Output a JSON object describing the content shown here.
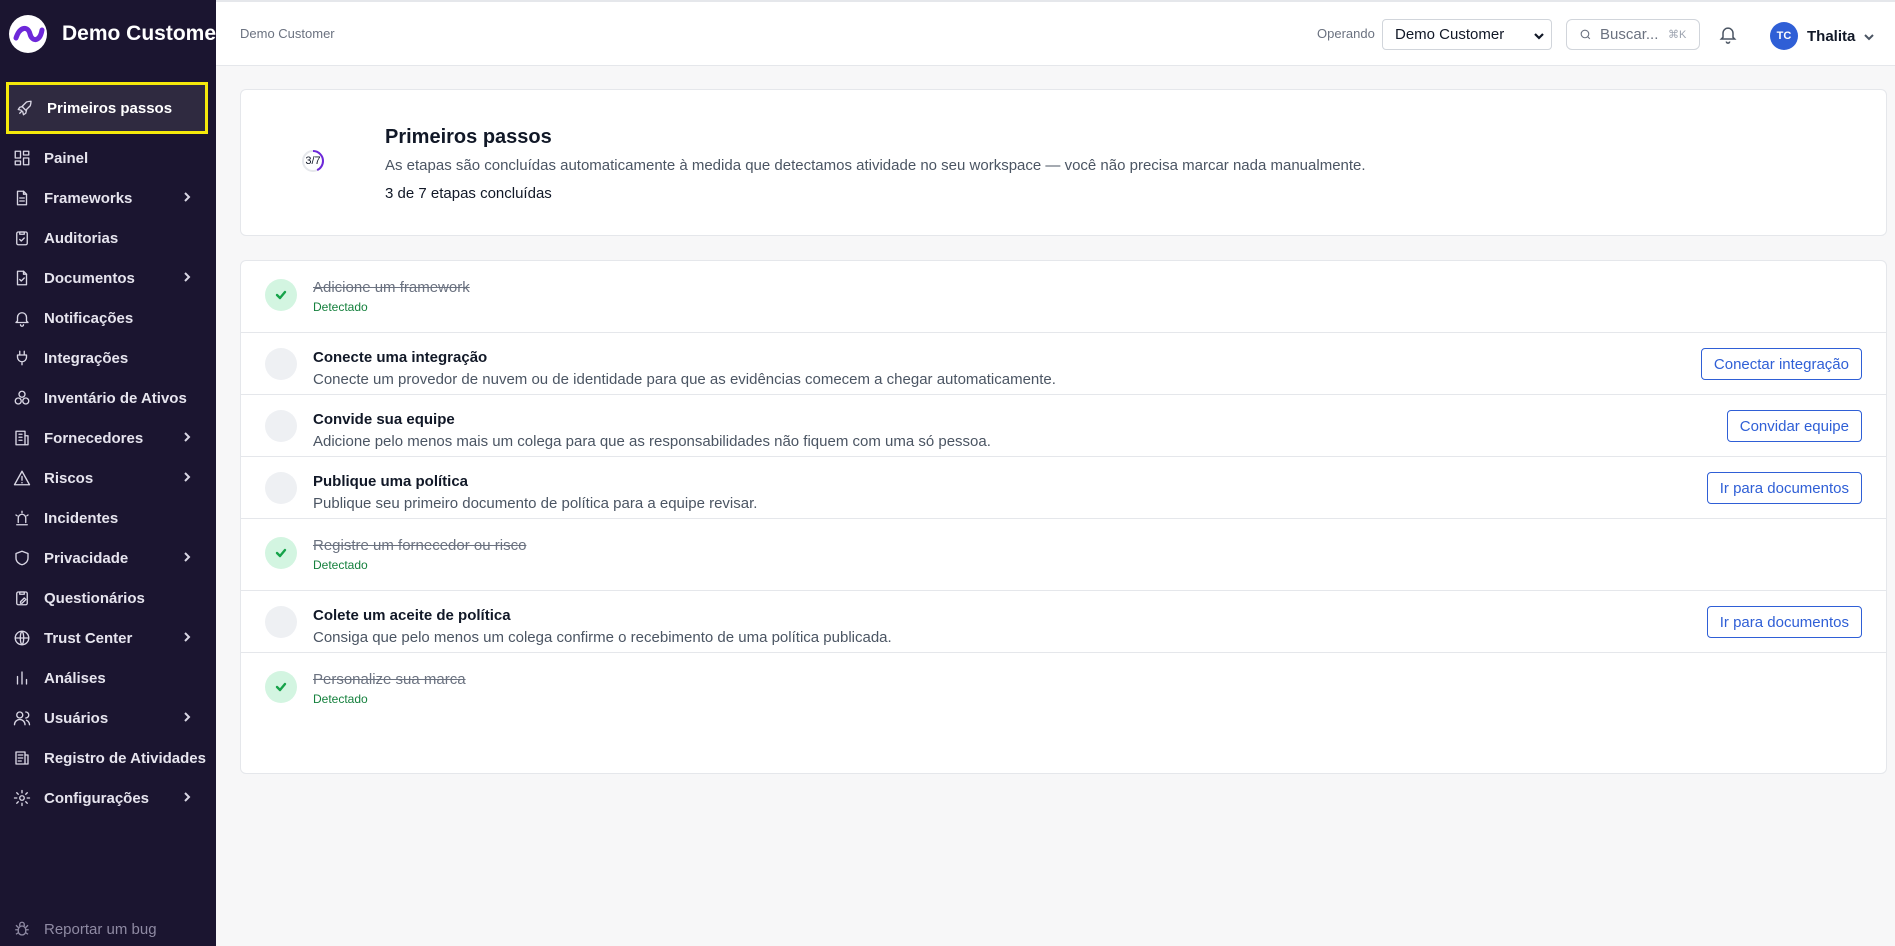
{
  "app": {
    "brand_name": "Demo Customer"
  },
  "sidebar": {
    "items": [
      {
        "label": "Primeiros passos",
        "icon": "rocket-icon",
        "active": true,
        "has_children": false
      },
      {
        "label": "Painel",
        "icon": "dashboard-icon",
        "has_children": false
      },
      {
        "label": "Frameworks",
        "icon": "file-text-icon",
        "has_children": true
      },
      {
        "label": "Auditorias",
        "icon": "clipboard-check-icon",
        "has_children": false
      },
      {
        "label": "Documentos",
        "icon": "file-check-icon",
        "has_children": true
      },
      {
        "label": "Notificações",
        "icon": "bell-icon",
        "has_children": false
      },
      {
        "label": "Integrações",
        "icon": "plug-icon",
        "has_children": false
      },
      {
        "label": "Inventário de Ativos",
        "icon": "boxes-icon",
        "has_children": false
      },
      {
        "label": "Fornecedores",
        "icon": "building-icon",
        "has_children": true
      },
      {
        "label": "Riscos",
        "icon": "warning-triangle-icon",
        "has_children": true
      },
      {
        "label": "Incidentes",
        "icon": "siren-icon",
        "has_children": false
      },
      {
        "label": "Privacidade",
        "icon": "shield-icon",
        "has_children": true
      },
      {
        "label": "Questionários",
        "icon": "clipboard-pen-icon",
        "has_children": false
      },
      {
        "label": "Trust Center",
        "icon": "globe-icon",
        "has_children": true
      },
      {
        "label": "Análises",
        "icon": "bar-chart-icon",
        "has_children": false
      },
      {
        "label": "Usuários",
        "icon": "users-icon",
        "has_children": true
      },
      {
        "label": "Registro de Atividades",
        "icon": "logs-icon",
        "has_children": false
      },
      {
        "label": "Configurações",
        "icon": "gear-icon",
        "has_children": true
      }
    ],
    "footer": {
      "label": "Reportar um bug",
      "icon": "bug-icon"
    }
  },
  "header": {
    "breadcrumb": "Demo Customer",
    "operando_label": "Operando",
    "operando_value": "Demo Customer",
    "search_placeholder": "Buscar...",
    "search_shortcut": "⌘K",
    "user": {
      "initials": "TC",
      "name": "Thalita"
    }
  },
  "summary": {
    "progress_label": "3/7",
    "progress_done": 3,
    "progress_total": 7,
    "title": "Primeiros passos",
    "description": "As etapas são concluídas automaticamente à medida que detectamos atividade no seu workspace — você não precisa marcar nada manualmente.",
    "count_text": "3 de 7 etapas concluídas"
  },
  "steps": [
    {
      "title": "Adicione um framework",
      "done": true,
      "status": "Detectado"
    },
    {
      "title": "Conecte uma integração",
      "done": false,
      "description": "Conecte um provedor de nuvem ou de identidade para que as evidências comecem a chegar automaticamente.",
      "action": "Conectar integração"
    },
    {
      "title": "Convide sua equipe",
      "done": false,
      "description": "Adicione pelo menos mais um colega para que as responsabilidades não fiquem com uma só pessoa.",
      "action": "Convidar equipe"
    },
    {
      "title": "Publique uma política",
      "done": false,
      "description": "Publique seu primeiro documento de política para a equipe revisar.",
      "action": "Ir para documentos"
    },
    {
      "title": "Registre um fornecedor ou risco",
      "done": true,
      "status": "Detectado"
    },
    {
      "title": "Colete um aceite de política",
      "done": false,
      "description": "Consiga que pelo menos um colega confirme o recebimento de uma política publicada.",
      "action": "Ir para documentos"
    },
    {
      "title": "Personalize sua marca",
      "done": true,
      "status": "Detectado"
    }
  ],
  "colors": {
    "sidebar_bg": "#1b1530",
    "accent": "#2f5fd6",
    "success": "#15803d",
    "highlight": "#f5e90b"
  }
}
